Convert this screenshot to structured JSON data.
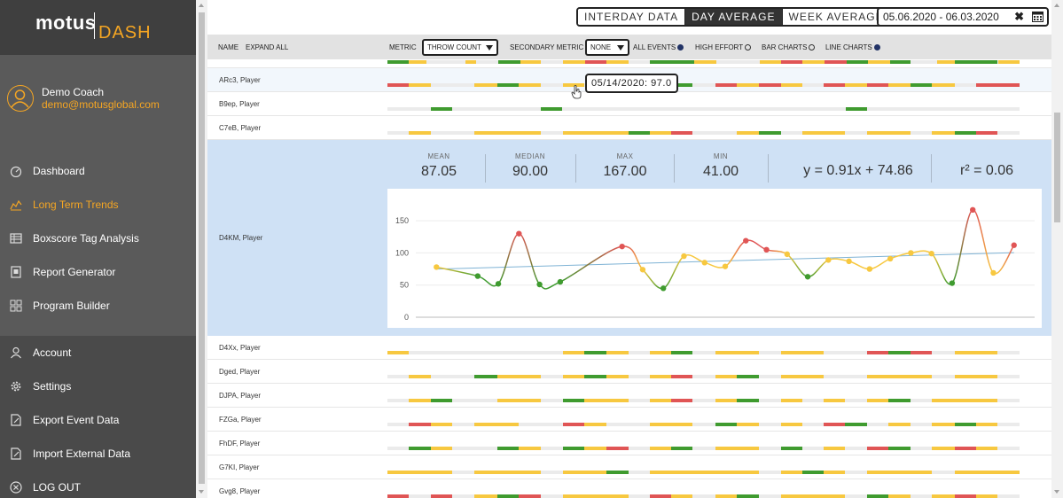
{
  "sidebar": {
    "logo_word": "motus",
    "logo_accent": "DASH",
    "user_name": "Demo Coach",
    "user_email": "demo@motusglobal.com",
    "nav": [
      {
        "label": "Dashboard",
        "icon": "dashboard-icon"
      },
      {
        "label": "Long Term Trends",
        "icon": "trends-icon",
        "active": true
      },
      {
        "label": "Boxscore Tag Analysis",
        "icon": "boxscore-icon"
      },
      {
        "label": "Report Generator",
        "icon": "report-icon"
      },
      {
        "label": "Program Builder",
        "icon": "program-icon"
      }
    ],
    "nav_bottom": [
      {
        "label": "Account",
        "icon": "user-icon"
      },
      {
        "label": "Settings",
        "icon": "gear-icon"
      },
      {
        "label": "Export Event Data",
        "icon": "export-icon"
      },
      {
        "label": "Import External Data",
        "icon": "import-icon"
      },
      {
        "label": "LOG OUT",
        "icon": "logout-icon"
      }
    ]
  },
  "header": {
    "toggle": [
      "INTERDAY DATA",
      "DAY AVERAGE",
      "WEEK AVERAGE"
    ],
    "toggle_selected": "DAY AVERAGE",
    "date_range": "05.06.2020 - 06.03.2020",
    "clear_glyph": "✖"
  },
  "filters": {
    "name_label": "NAME",
    "expand_label": "EXPAND ALL",
    "metric_label": "METRIC",
    "metric_value": "THROW COUNT",
    "secondary_label": "SECONDARY METRIC",
    "secondary_value": "NONE",
    "options": [
      {
        "label": "ALL EVENTS",
        "checked": true
      },
      {
        "label": "HIGH EFFORT",
        "checked": false
      },
      {
        "label": "BAR CHARTS",
        "checked": false
      },
      {
        "label": "LINE CHARTS",
        "checked": true
      }
    ]
  },
  "tooltip": "05/14/2020: 97.0",
  "colors": {
    "green": "#3f9b2f",
    "yellow": "#f7c840",
    "red": "#e05555",
    "track": "#ebebeb",
    "orange": "#f5a623"
  },
  "players_above": [
    {
      "name": "ARc3, Player"
    },
    {
      "name": "B9ep, Player"
    },
    {
      "name": "C7eB, Player"
    }
  ],
  "expanded": {
    "name": "D4KM, Player",
    "stats": [
      {
        "label": "MEAN",
        "value": "87.05"
      },
      {
        "label": "MEDIAN",
        "value": "90.00"
      },
      {
        "label": "MAX",
        "value": "167.00"
      },
      {
        "label": "MIN",
        "value": "41.00"
      }
    ],
    "regression": "y = 0.91x + 74.86",
    "r2": "r² = 0.06"
  },
  "players_below": [
    {
      "name": "D4Xx, Player"
    },
    {
      "name": "Dged, Player"
    },
    {
      "name": "DJPA, Player"
    },
    {
      "name": "FZGa, Player"
    },
    {
      "name": "FhDF, Player"
    },
    {
      "name": "G7KI, Player"
    },
    {
      "name": "Gvg8, Player"
    }
  ],
  "chart_data": {
    "type": "line",
    "y_ticks": [
      150,
      100,
      50,
      0
    ],
    "ylim": [
      0,
      175
    ],
    "grid": "horizontal",
    "x": [
      1,
      3,
      4,
      5,
      6,
      7,
      10,
      11,
      12,
      13,
      14,
      15,
      16,
      17,
      18,
      19,
      20,
      21,
      22,
      23,
      24,
      25,
      26,
      27,
      28,
      29
    ],
    "values": [
      78,
      64,
      52,
      130,
      51,
      55,
      110,
      74,
      45,
      95,
      85,
      79,
      119,
      105,
      98,
      63,
      89,
      87,
      75,
      91,
      100,
      99,
      53,
      167,
      69,
      112
    ],
    "trend": {
      "slope": 0.91,
      "intercept": 74.86
    }
  }
}
